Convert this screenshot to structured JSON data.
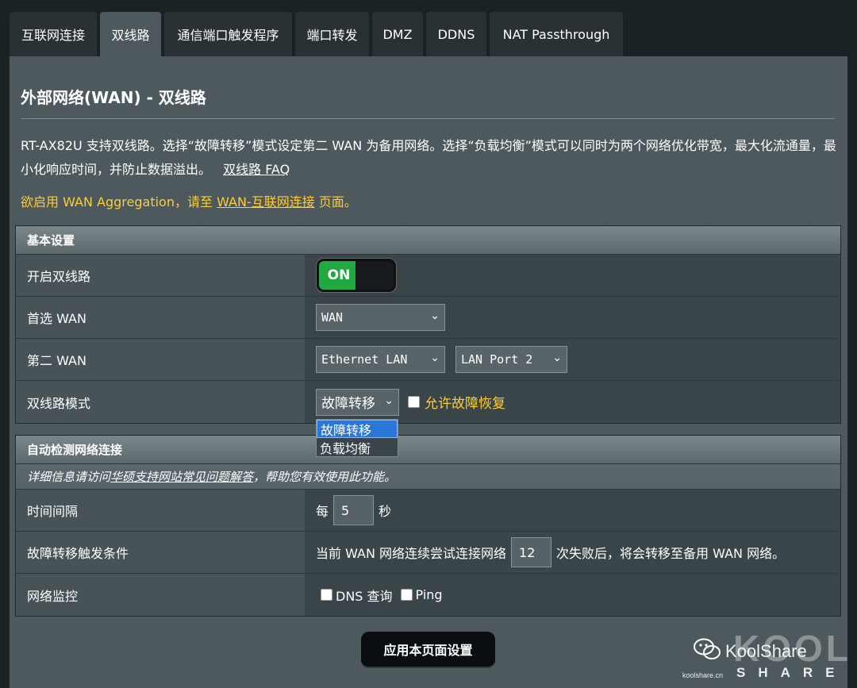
{
  "tabs": [
    {
      "label": "互联网连接",
      "active": false
    },
    {
      "label": "双线路",
      "active": true
    },
    {
      "label": "通信端口触发程序",
      "active": false
    },
    {
      "label": "端口转发",
      "active": false
    },
    {
      "label": "DMZ",
      "active": false
    },
    {
      "label": "DDNS",
      "active": false
    },
    {
      "label": "NAT Passthrough",
      "active": false
    }
  ],
  "page": {
    "title": "外部网络(WAN) - 双线路",
    "description": "RT-AX82U 支持双线路。选择“故障转移”模式设定第二 WAN 为备用网络。选择“负载均衡”模式可以同时为两个网络优化带宽，最大化流通量，最小化响应时间，并防止数据溢出。",
    "faq_link": "双线路 FAQ",
    "notice_prefix": "欲启用 WAN Aggregation，请至 ",
    "notice_link": "WAN-互联网连接",
    "notice_suffix": " 页面。"
  },
  "basic": {
    "header": "基本设置",
    "enable_label": "开启双线路",
    "enable_state": "ON",
    "primary_label": "首选 WAN",
    "primary_value": "WAN",
    "secondary_label": "第二 WAN",
    "secondary_value": "Ethernet LAN",
    "secondary_port": "LAN Port 2",
    "mode_label": "双线路模式",
    "mode_value": "故障转移",
    "allow_failback": "允许故障恢复",
    "mode_options": [
      "故障转移",
      "负载均衡"
    ]
  },
  "detect": {
    "header": "自动检测网络连接",
    "hint_prefix": "详细信息请访问 ",
    "hint_link": "华硕支持网站常见问题解答",
    "hint_suffix": "，帮助您有效使用此功能。",
    "interval_label": "时间间隔",
    "interval_prefix": "每",
    "interval_value": "5",
    "interval_suffix": "秒",
    "trigger_label": "故障转移触发条件",
    "trigger_prefix": "当前 WAN 网络连续尝试连接网络",
    "trigger_value": "12",
    "trigger_suffix": "次失败后，将会转移至备用 WAN 网络。",
    "monitor_label": "网络监控",
    "monitor_dns": "DNS 查询",
    "monitor_ping": "Ping"
  },
  "apply_button": "应用本页面设置",
  "watermark": {
    "brand": "KoolShare",
    "logo_text": "KOOL",
    "share": "SHARE",
    "url": "koolshare.cn"
  },
  "colors": {
    "panel": "#4d595d",
    "accent_yellow": "#ffcc33",
    "toggle_on": "#21a841",
    "selected_option": "#2a77d6"
  }
}
